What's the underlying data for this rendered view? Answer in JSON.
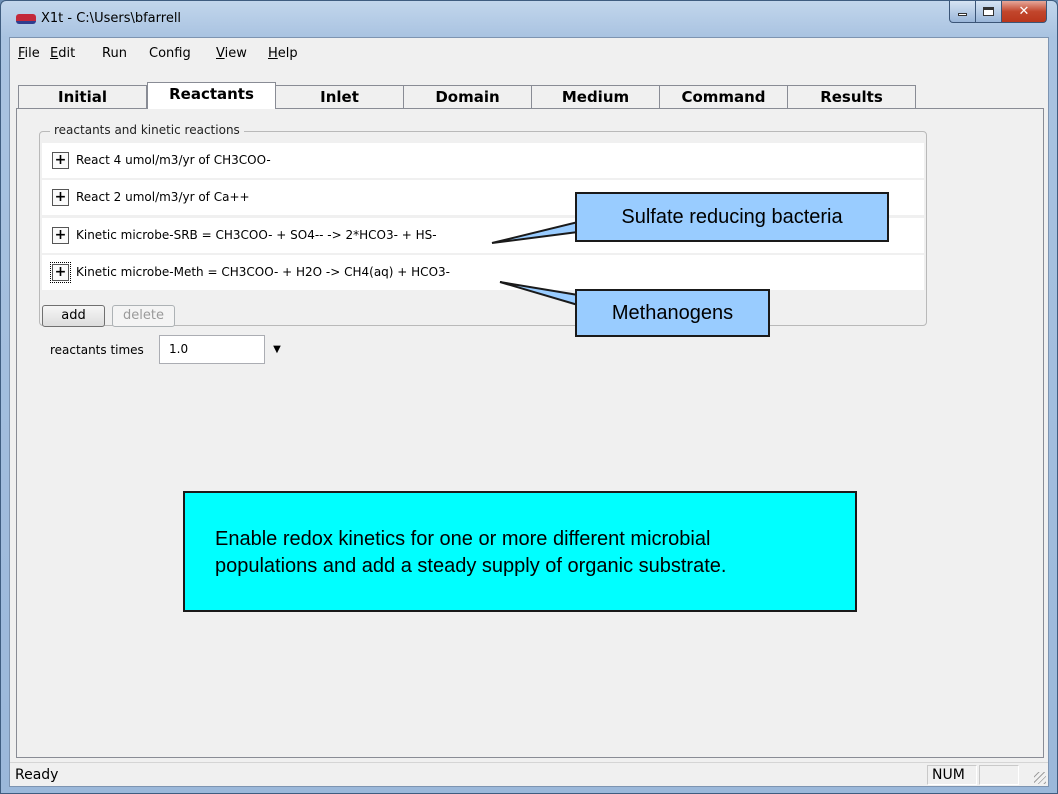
{
  "window": {
    "title": "X1t - C:\\Users\\bfarrell",
    "icon": "app-icon"
  },
  "menu": [
    {
      "label": "File",
      "mnemonic": "F",
      "rest": "ile"
    },
    {
      "label": "Edit",
      "mnemonic": "E",
      "rest": "dit"
    },
    {
      "label": "Run",
      "mnemonic": "",
      "rest": "Run"
    },
    {
      "label": "Config",
      "mnemonic": "",
      "rest": "Config"
    },
    {
      "label": "View",
      "mnemonic": "V",
      "rest": "iew"
    },
    {
      "label": "Help",
      "mnemonic": "H",
      "rest": "elp"
    }
  ],
  "tabs": [
    {
      "label": "Initial",
      "active": false
    },
    {
      "label": "Reactants",
      "active": true
    },
    {
      "label": "Inlet",
      "active": false
    },
    {
      "label": "Domain",
      "active": false
    },
    {
      "label": "Medium",
      "active": false
    },
    {
      "label": "Command",
      "active": false
    },
    {
      "label": "Results",
      "active": false
    }
  ],
  "reactants": {
    "group_label": "reactants and kinetic reactions",
    "items": [
      {
        "label": "React 4 umol/m3/yr of CH3COO-"
      },
      {
        "label": "React 2 umol/m3/yr of Ca++"
      },
      {
        "label": "Kinetic microbe-SRB = CH3COO-  + SO4--  -> 2*HCO3-  + HS-"
      },
      {
        "label": "Kinetic microbe-Meth = CH3COO-  + H2O  -> CH4(aq)  + HCO3-"
      }
    ],
    "add_label": "add",
    "delete_label": "delete"
  },
  "reactants_times": {
    "label": "reactants times",
    "value": "1.0"
  },
  "callouts": {
    "srb": "Sulfate reducing bacteria",
    "meth": "Methanogens",
    "main_line1": "Enable redox kinetics for one or more different microbial",
    "main_line2": "populations and add a steady supply of organic substrate."
  },
  "colors": {
    "callout_blue": "#99ccff",
    "callout_cyan": "#00ffff"
  },
  "status": {
    "text": "Ready",
    "num": "NUM"
  }
}
